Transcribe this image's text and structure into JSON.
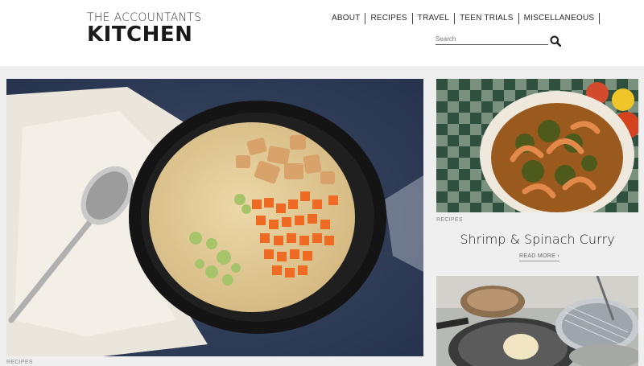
{
  "site": {
    "logo_top": "THE ACCOUNTANTS",
    "logo_main": "KITCHEN"
  },
  "nav": {
    "items": [
      {
        "label": "ABOUT"
      },
      {
        "label": "RECIPES"
      },
      {
        "label": "TRAVEL"
      },
      {
        "label": "TEEN TRIALS"
      },
      {
        "label": "MISCELLANEOUS"
      }
    ]
  },
  "search": {
    "placeholder": "Search",
    "icon": "search-icon"
  },
  "hero": {
    "category": "RECIPES"
  },
  "card1": {
    "category": "RECIPES",
    "title": "Shrimp & Spinach Curry",
    "read_more": "READ MORE ›"
  },
  "colors": {
    "background": "#efefef",
    "header_bg": "#ffffff",
    "text_dark": "#222222",
    "muted": "#888888"
  }
}
